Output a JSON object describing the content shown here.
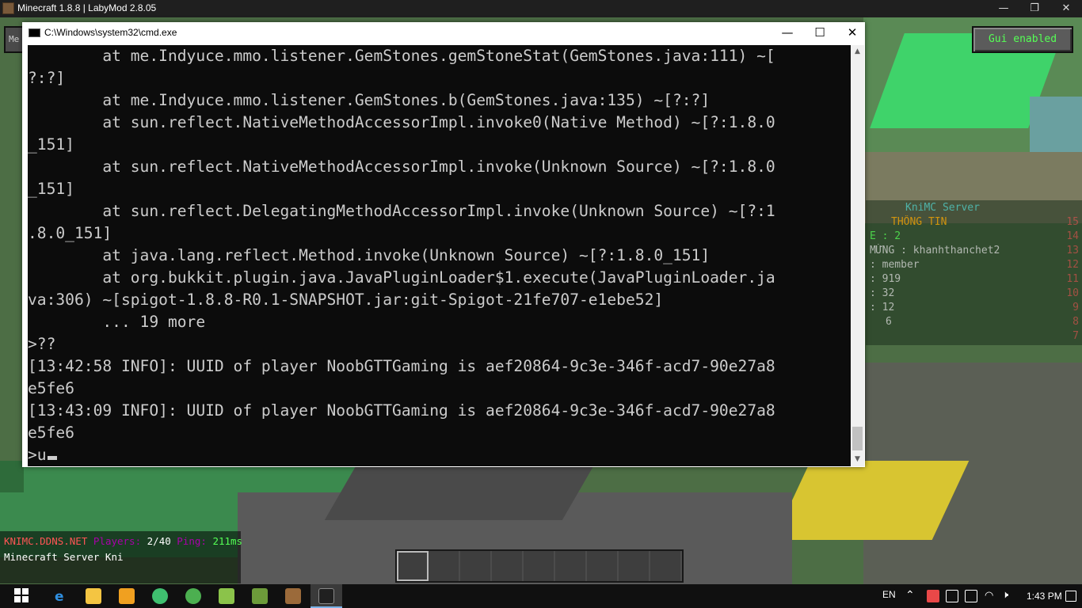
{
  "mc_window": {
    "title": "Minecraft 1.8.8 | LabyMod 2.8.05",
    "minimize": "—",
    "maximize": "❐",
    "close": "✕"
  },
  "hud": {
    "gui_button": "Gui enabled",
    "left_button": "Me",
    "scoreboard": {
      "title": "KniMC Server",
      "lines": [
        {
          "text": "THÔNG TIN",
          "num": "15",
          "color": "#ffaa00"
        },
        {
          "text": "E : 2",
          "num": "14",
          "color": "#55ff55"
        },
        {
          "text": "MỪNG : khanhthanchet2",
          "num": "13",
          "color": "#dddddd"
        },
        {
          "text": ": member",
          "num": "12",
          "color": "#dddddd"
        },
        {
          "text": ": 919",
          "num": "11",
          "color": "#dddddd"
        },
        {
          "text": ": 32",
          "num": "10",
          "color": "#dddddd"
        },
        {
          "text": ": 12",
          "num": "9",
          "color": "#dddddd"
        },
        {
          "text": "6",
          "num": "8",
          "color": "#dddddd"
        },
        {
          "text": "",
          "num": "7",
          "color": "#ff5555"
        }
      ]
    },
    "server_info": {
      "host": "KNIMC.DDNS.NET",
      "players_label": "Players:",
      "players": "2/40",
      "ping_label": "Ping:",
      "ping": "211ms",
      "motd": "Minecraft Server Kni"
    }
  },
  "cmd_window": {
    "title": "C:\\Windows\\system32\\cmd.exe",
    "minimize": "—",
    "maximize": "☐",
    "close": "✕",
    "lines": [
      "        at me.Indyuce.mmo.listener.GemStones.gemStoneStat(GemStones.java:111) ~[",
      "?:?]",
      "        at me.Indyuce.mmo.listener.GemStones.b(GemStones.java:135) ~[?:?]",
      "        at sun.reflect.NativeMethodAccessorImpl.invoke0(Native Method) ~[?:1.8.0",
      "_151]",
      "        at sun.reflect.NativeMethodAccessorImpl.invoke(Unknown Source) ~[?:1.8.0",
      "_151]",
      "        at sun.reflect.DelegatingMethodAccessorImpl.invoke(Unknown Source) ~[?:1",
      ".8.0_151]",
      "        at java.lang.reflect.Method.invoke(Unknown Source) ~[?:1.8.0_151]",
      "        at org.bukkit.plugin.java.JavaPluginLoader$1.execute(JavaPluginLoader.ja",
      "va:306) ~[spigot-1.8.8-R0.1-SNAPSHOT.jar:git-Spigot-21fe707-e1ebe52]",
      "        ... 19 more",
      ">??",
      "[13:42:58 INFO]: UUID of player NoobGTTGaming is aef20864-9c3e-346f-acd7-90e27a8",
      "e5fe6",
      "[13:43:09 INFO]: UUID of player NoobGTTGaming is aef20864-9c3e-346f-acd7-90e27a8",
      "e5fe6"
    ],
    "input_line": ">u"
  },
  "taskbar": {
    "language": "EN",
    "time": "1:43 PM",
    "apps": [
      {
        "name": "start-icon",
        "color": "#ffffff"
      },
      {
        "name": "edge-icon",
        "color": "#2f8fe0"
      },
      {
        "name": "file-explorer-icon",
        "color": "#f4c542"
      },
      {
        "name": "media-player-icon",
        "color": "#f0a020"
      },
      {
        "name": "photos-icon",
        "color": "#3fbf6f"
      },
      {
        "name": "cc-cleaner-icon",
        "color": "#4caf50"
      },
      {
        "name": "tlauncher-icon",
        "color": "#8bc34a"
      },
      {
        "name": "minecraft-grass-icon",
        "color": "#6d9b3a"
      },
      {
        "name": "minecraft-crafting-icon",
        "color": "#9b6a3a"
      },
      {
        "name": "cmd-icon",
        "color": "#202020"
      }
    ]
  }
}
